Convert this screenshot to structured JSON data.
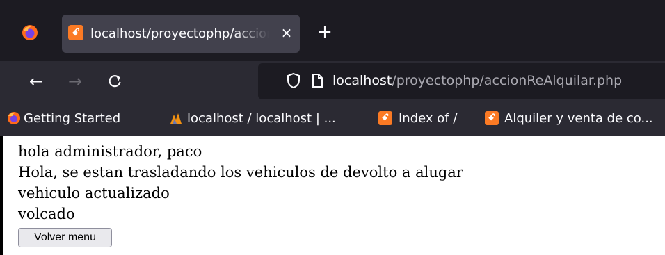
{
  "browser": {
    "active_tab": {
      "title": "localhost/proyectophp/accionReAlquilar.php",
      "favicon": "xampp-icon",
      "close_glyph": "×"
    },
    "new_tab_glyph": "+",
    "nav": {
      "back_glyph": "←",
      "forward_glyph": "→",
      "reload_glyph": "C"
    },
    "url": {
      "host": "localhost",
      "path": "/proyectophp/accionReAlquilar.php"
    },
    "bookmarks": [
      {
        "label": "Getting Started",
        "icon": "firefox-icon"
      },
      {
        "label": "localhost / localhost | ...",
        "icon": "phpmyadmin-icon"
      },
      {
        "label": "Index of /",
        "icon": "xampp-icon"
      },
      {
        "label": "Alquiler y venta de co...",
        "icon": "xampp-icon"
      }
    ],
    "colors": {
      "tabstrip": "#1c1b22",
      "active_tab": "#42414d",
      "toolbar": "#2b2a33",
      "xampp_orange": "#fb7a24"
    }
  },
  "page": {
    "lines": [
      "hola administrador, paco",
      "Hola, se estan trasladando los vehiculos de devolto a alugar",
      "vehiculo actualizado",
      "volcado"
    ],
    "back_button_label": "Volver menu"
  }
}
